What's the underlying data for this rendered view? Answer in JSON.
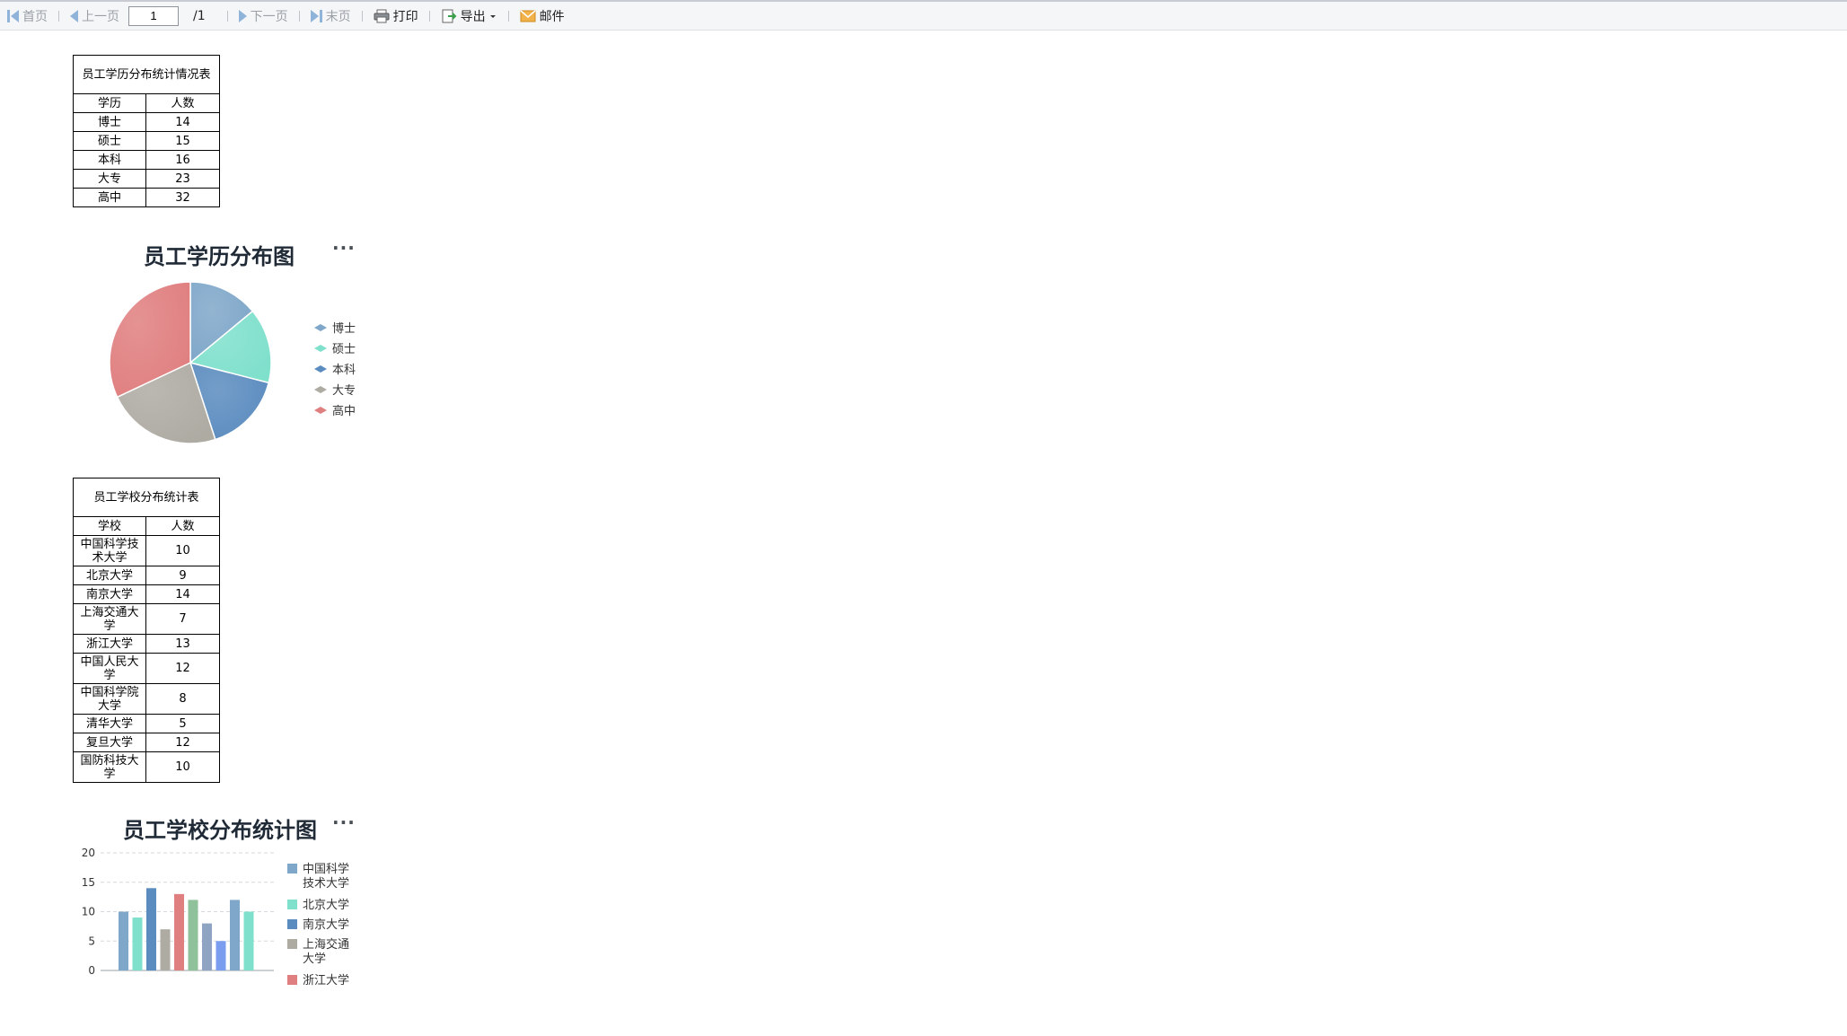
{
  "toolbar": {
    "first": "首页",
    "prev": "上一页",
    "page_value": "1",
    "page_total": "/1",
    "next": "下一页",
    "last": "末页",
    "print": "打印",
    "export": "导出",
    "mail": "邮件"
  },
  "edu_table": {
    "title": "员工学历分布统计情况表",
    "headers": [
      "学历",
      "人数"
    ],
    "rows": [
      [
        "博士",
        "14"
      ],
      [
        "硕士",
        "15"
      ],
      [
        "本科",
        "16"
      ],
      [
        "大专",
        "23"
      ],
      [
        "高中",
        "32"
      ]
    ]
  },
  "school_table": {
    "title": "员工学校分布统计表",
    "headers": [
      "学校",
      "人数"
    ],
    "rows": [
      [
        "中国科学技术大学",
        "10"
      ],
      [
        "北京大学",
        "9"
      ],
      [
        "南京大学",
        "14"
      ],
      [
        "上海交通大学",
        "7"
      ],
      [
        "浙江大学",
        "13"
      ],
      [
        "中国人民大学",
        "12"
      ],
      [
        "中国科学院大学",
        "8"
      ],
      [
        "清华大学",
        "5"
      ],
      [
        "复旦大学",
        "12"
      ],
      [
        "国防科技大学",
        "10"
      ]
    ]
  },
  "more_icon": "more-dots-icon",
  "chart_data": [
    {
      "type": "pie",
      "title": "员工学历分布图",
      "categories": [
        "博士",
        "硕士",
        "本科",
        "大专",
        "高中"
      ],
      "values": [
        14,
        15,
        16,
        23,
        32
      ],
      "colors": [
        "#7fa7c9",
        "#7fe0cc",
        "#5b8cbf",
        "#aeaba3",
        "#e07f80"
      ],
      "legend": "right"
    },
    {
      "type": "bar",
      "title": "员工学校分布统计图",
      "categories": [
        "中国科学技术大学",
        "北京大学",
        "南京大学",
        "上海交通大学",
        "浙江大学",
        "中国人民大学",
        "中国科学院大学",
        "清华大学",
        "复旦大学",
        "国防科技大学"
      ],
      "values": [
        10,
        9,
        14,
        7,
        13,
        12,
        8,
        5,
        12,
        10
      ],
      "colors": [
        "#7fa7c9",
        "#7fe0cc",
        "#5b8cbf",
        "#aeaba3",
        "#e07f80",
        "#8fc29a",
        "#8fa3c2",
        "#7a9df0",
        "#7fa7c9",
        "#7fe0cc"
      ],
      "yticks": [
        0,
        5,
        10,
        15,
        20
      ],
      "ylim": [
        0,
        20
      ],
      "legend_entries": [
        "中国科学技术大学",
        "北京大学",
        "南京大学",
        "上海交通大学",
        "浙江大学"
      ],
      "legend": "right",
      "grid": true
    }
  ]
}
